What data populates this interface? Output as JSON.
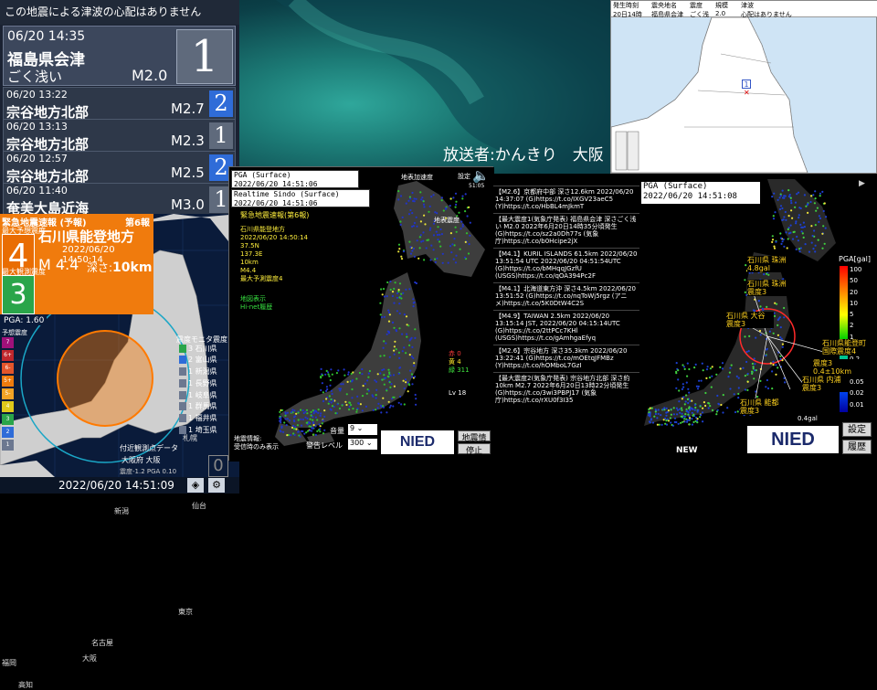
{
  "tsunami": "この地震による津波の心配はありません",
  "latest": {
    "datetime": "06/20 14:35",
    "place": "福島県会津",
    "depth": "ごく浅い",
    "mag": "M2.0",
    "intensity": "1"
  },
  "history": [
    {
      "datetime": "06/20 13:22",
      "place": "宗谷地方北部",
      "mag": "M2.7",
      "intensity": "2",
      "color": "#2f6cd8"
    },
    {
      "datetime": "06/20 13:13",
      "place": "宗谷地方北部",
      "mag": "M2.3",
      "intensity": "1",
      "color": "#5f6a7c"
    },
    {
      "datetime": "06/20 12:57",
      "place": "宗谷地方北部",
      "mag": "M2.5",
      "intensity": "2",
      "color": "#2f6cd8"
    },
    {
      "datetime": "06/20 11:40",
      "place": "奄美大島近海",
      "mag": "M3.0",
      "intensity": "1",
      "color": "#5f6a7c"
    }
  ],
  "eew": {
    "header": "緊急地震速報 (予報)",
    "number": "第6報",
    "max_label": "最大予想震度",
    "max_int": "4",
    "region": "石川県能登地方",
    "time": "2022/06/20 14:50:14",
    "mag": "M 4.4",
    "depth_label": "深さ:",
    "depth": "10km",
    "obs_label": "最大観測震度",
    "obs_int": "3"
  },
  "pga_label": "PGA: 1.60",
  "left_map": {
    "rows": [
      {
        "label": "3 石川県",
        "color": "#2aa54a"
      },
      {
        "label": "2 富山県",
        "color": "#2f6cd8"
      },
      {
        "label": "1 新潟県",
        "color": "#6c7890"
      },
      {
        "label": "1 長野県",
        "color": "#6c7890"
      },
      {
        "label": "1 岐阜県",
        "color": "#6c7890"
      },
      {
        "label": "1 群馬県",
        "color": "#6c7890"
      },
      {
        "label": "1 福井県",
        "color": "#6c7890"
      },
      {
        "label": "1 埼玉県",
        "color": "#6c7890"
      }
    ],
    "monitor_label": "震度モニタ震度",
    "scale_label": "予想震度",
    "scale": [
      "7",
      "6+",
      "6-",
      "5+",
      "5-",
      "4",
      "3",
      "2",
      "1"
    ],
    "places": [
      "札幌",
      "仙台",
      "新潟",
      "東京",
      "名古屋",
      "大阪",
      "高知",
      "福岡"
    ],
    "nearby_label": "付近観測点データ",
    "nearby_place": "大阪府 大阪",
    "nearby_values": "震度-1.2  PGA 0.10",
    "nearby_int": "0"
  },
  "timestamp": "2022/06/20 14:51:09",
  "broadcaster": "放送者:かんきり　大阪",
  "quake_map": {
    "header_cols": [
      "発生時刻",
      "震央地名",
      "震度",
      "規模",
      "津波"
    ],
    "header_vals": [
      "20日14時35分",
      "福島県会津",
      "ごく浅い",
      "2.0",
      "心配はありません"
    ],
    "marker": "1"
  },
  "kyoshin": {
    "pga_label": "PGA (Surface)",
    "pga_time": "2022/06/20 14:51:06",
    "rt_label": "Realtime Sindo (Surface)",
    "rt_time": "2022/06/20 14:51:06",
    "settings": "設定",
    "clock": "51:05",
    "surface_acc": "地表加速度",
    "surface_int": "地表震度",
    "eew_title": "緊急地震速報(第6報)",
    "eew_lines": [
      "石川県能登地方",
      "2022/06/20 14:50:14",
      "37.5N",
      "137.3E",
      "10km",
      "M4.4",
      "最大予測震度4"
    ],
    "map_lines": [
      "地図表示",
      "Hi-net履歴"
    ],
    "counts": [
      {
        "label": "赤 0",
        "color": "#ff3b3b"
      },
      {
        "label": "黄 4",
        "color": "#ffe92c"
      },
      {
        "label": "緑 311",
        "color": "#3fe33f"
      }
    ],
    "level": "Lv 18",
    "quake_info": "地震情報:",
    "quake_info2": "受信時のみ表示",
    "volume_label": "音量",
    "volume_value": "9",
    "alarm_label": "警告レベル",
    "alarm_value": "300",
    "nied": "NIED",
    "btn_quake": "地震情報",
    "btn_stop": "停止"
  },
  "posts": [
    {
      "text": "【M2.6】京都府中部 深さ12.6km 2022/06/20 14:37:07 (G)https://t.co/IXGV23aeC5 (Y)https://t.co/HbBL4mJkmT"
    },
    {
      "text": "【最大震度1(気象庁発表) 福島県会津 深さごく浅い M2.0 2022年6月20日14時35分頃発生 (G)https://t.co/sz2a0Dh77s (気象庁)https://t.co/b0Hcipe2jX"
    },
    {
      "text": "【M4.1】KURIL ISLANDS 61.5km 2022/06/20 13:51:54 UTC 2022/06/20 04:51:54UTC (G)https://t.co/bMHqqJGzfU (USGS)https://t.co/qOA394Pc2F"
    },
    {
      "text": "【M4.1】北海道東方沖 深さ4.5km 2022/06/20 13:51:52 (G)https://t.co/nqToWj5rgz (アニメ)https://t.co/5K0DtW4C2S"
    },
    {
      "text": "【M4.9】TAIWAN 2.5km 2022/06/20 13:15:14 JST, 2022/06/20 04:15:14UTC (G)https://t.co/2ttPCc7KHl (USGS)https://t.co/gAmhgaEfyq"
    },
    {
      "text": "【M2.6】宗谷地方 深さ35.3km 2022/06/20 13:22:41 (G)https://t.co/mOEtqJFMBz (Y)https://t.co/hOMboL7GzI"
    },
    {
      "text": "【最大震度2(気象庁発表) 宗谷地方北部 深さ約10km M2.7 2022年6月20日13時22分頃発生 (G)https://t.co/3wi3PBPJ17 (気象庁)https://t.co/rXU0f3I35"
    }
  ],
  "pga_panel": {
    "label": "PGA (Surface)",
    "time": "2022/06/20 14:51:08",
    "unit": "PGA[gal]",
    "scale": [
      "100",
      "50",
      "20",
      "10",
      "5",
      "2",
      "1",
      "0.5",
      "0.2",
      "0.1",
      "0.05",
      "0.02",
      "0.01"
    ],
    "gauge": "0.4gal",
    "annotations": [
      "石川県 珠洲 4.8gal",
      "石川県 珠洲 震度3",
      "石川県 大谷 震度3",
      "石川県能登町 国際震度4",
      "震度3 0.4±10km",
      "石川県 内浦 震度3",
      "石川県 能都 震度3"
    ],
    "nied": "NIED",
    "new": "NEW",
    "btn_settings": "設定",
    "btn_history": "履歴"
  }
}
